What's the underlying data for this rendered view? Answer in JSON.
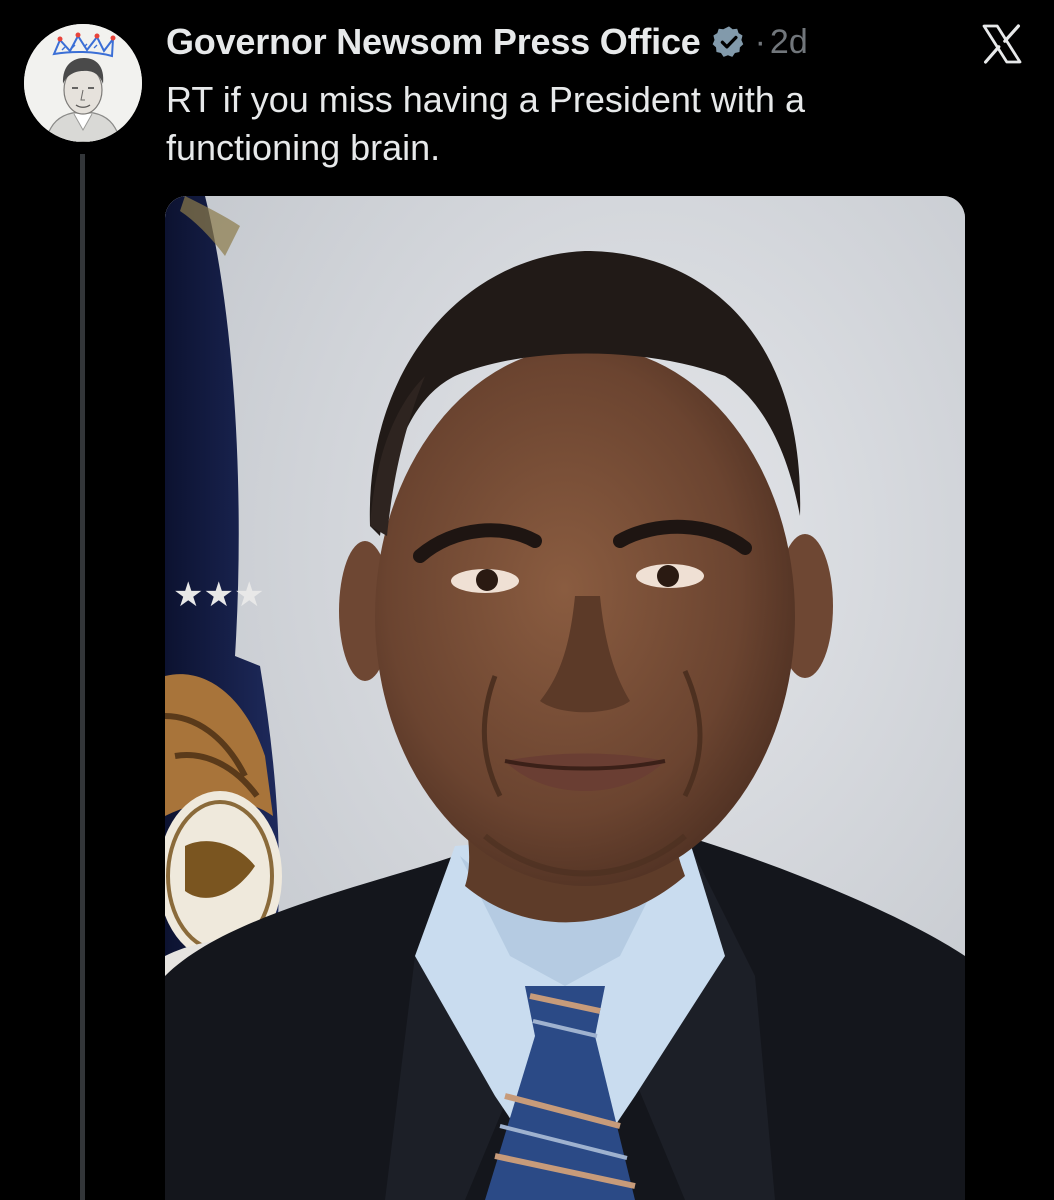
{
  "post": {
    "author_name": "Governor Newsom Press Office",
    "separator": "·",
    "time": "2d",
    "text": "RT if you miss having a President with a functioning brain."
  },
  "icons": {
    "verified": "verified-badge-icon",
    "platform": "x-logo-icon"
  },
  "colors": {
    "background": "#000000",
    "text_primary": "#e7e9ea",
    "text_secondary": "#71767b",
    "thread_line": "#333639",
    "verified_badge": "#829aab"
  }
}
